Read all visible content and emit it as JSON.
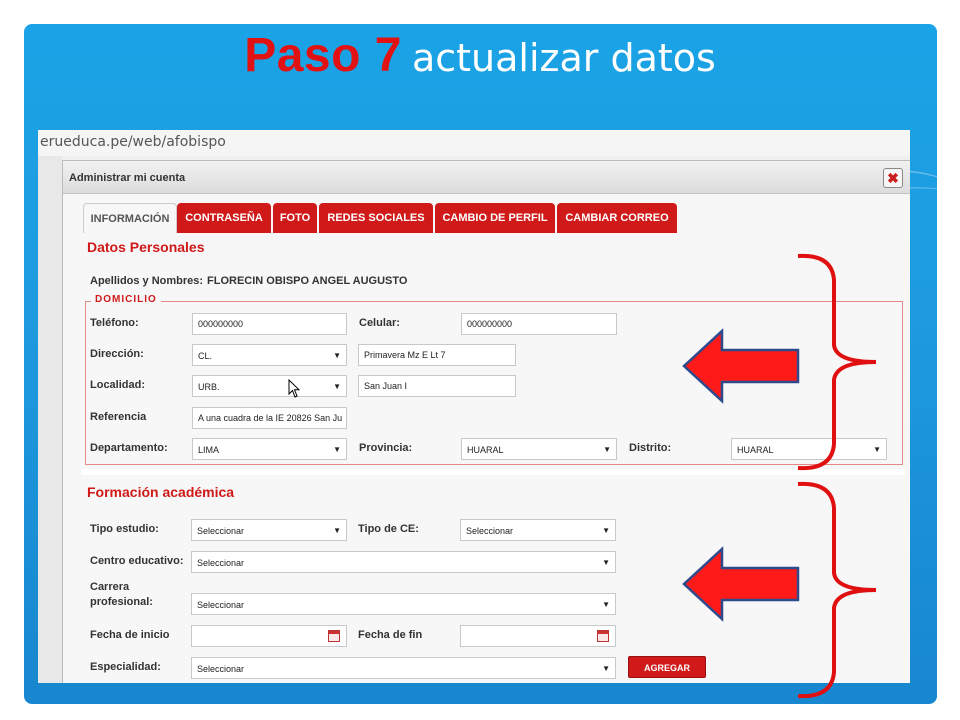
{
  "slide": {
    "title_bold": "Paso 7",
    "title_rest": "actualizar datos"
  },
  "browser": {
    "url": "erueduca.pe/web/afobispo"
  },
  "modal": {
    "title": "Administrar mi cuenta",
    "close_label": "✖"
  },
  "tabs": [
    {
      "label": "INFORMACIÓN",
      "active": true
    },
    {
      "label": "CONTRASEÑA"
    },
    {
      "label": "FOTO"
    },
    {
      "label": "REDES SOCIALES"
    },
    {
      "label": "CAMBIO DE PERFIL"
    },
    {
      "label": "CAMBIAR CORREO"
    }
  ],
  "personal": {
    "section_title": "Datos Personales",
    "names_label": "Apellidos y Nombres:",
    "names_value": "FLORECIN OBISPO ANGEL AUGUSTO",
    "domicilio_legend": "DOMICILIO",
    "telefono_label": "Teléfono:",
    "telefono_value": "000000000",
    "celular_label": "Celular:",
    "celular_value": "000000000",
    "direccion_label": "Dirección:",
    "direccion_select": "CL.",
    "direccion_text": "Primavera Mz E Lt 7",
    "localidad_label": "Localidad:",
    "localidad_select": "URB.",
    "localidad_text": "San Juan I",
    "referencia_label": "Referencia",
    "referencia_value": "A una cuadra de la IE 20826 San Ju",
    "departamento_label": "Departamento:",
    "departamento_value": "LIMA",
    "provincia_label": "Provincia:",
    "provincia_value": "HUARAL",
    "distrito_label": "Distrito:",
    "distrito_value": "HUARAL"
  },
  "academic": {
    "section_title": "Formación académica",
    "tipo_estudio_label": "Tipo estudio:",
    "tipo_estudio_value": "Seleccionar",
    "tipo_ce_label": "Tipo de CE:",
    "tipo_ce_value": "Seleccionar",
    "centro_label": "Centro educativo:",
    "centro_value": "Seleccionar",
    "carrera_label_1": "Carrera",
    "carrera_label_2": "profesional:",
    "carrera_value": "Seleccionar",
    "fecha_inicio_label": "Fecha de inicio",
    "fecha_fin_label": "Fecha de fin",
    "especialidad_label": "Especialidad:",
    "especialidad_value": "Seleccionar",
    "agregar_label": "AGREGAR"
  },
  "icons": {
    "dropdown": "▼"
  },
  "colors": {
    "accent": "#d01919",
    "slide_bg": "#1e9be0",
    "title_red": "#e31212",
    "arrow_red": "#ff0000",
    "arrow_outline": "#2c4a8c"
  }
}
